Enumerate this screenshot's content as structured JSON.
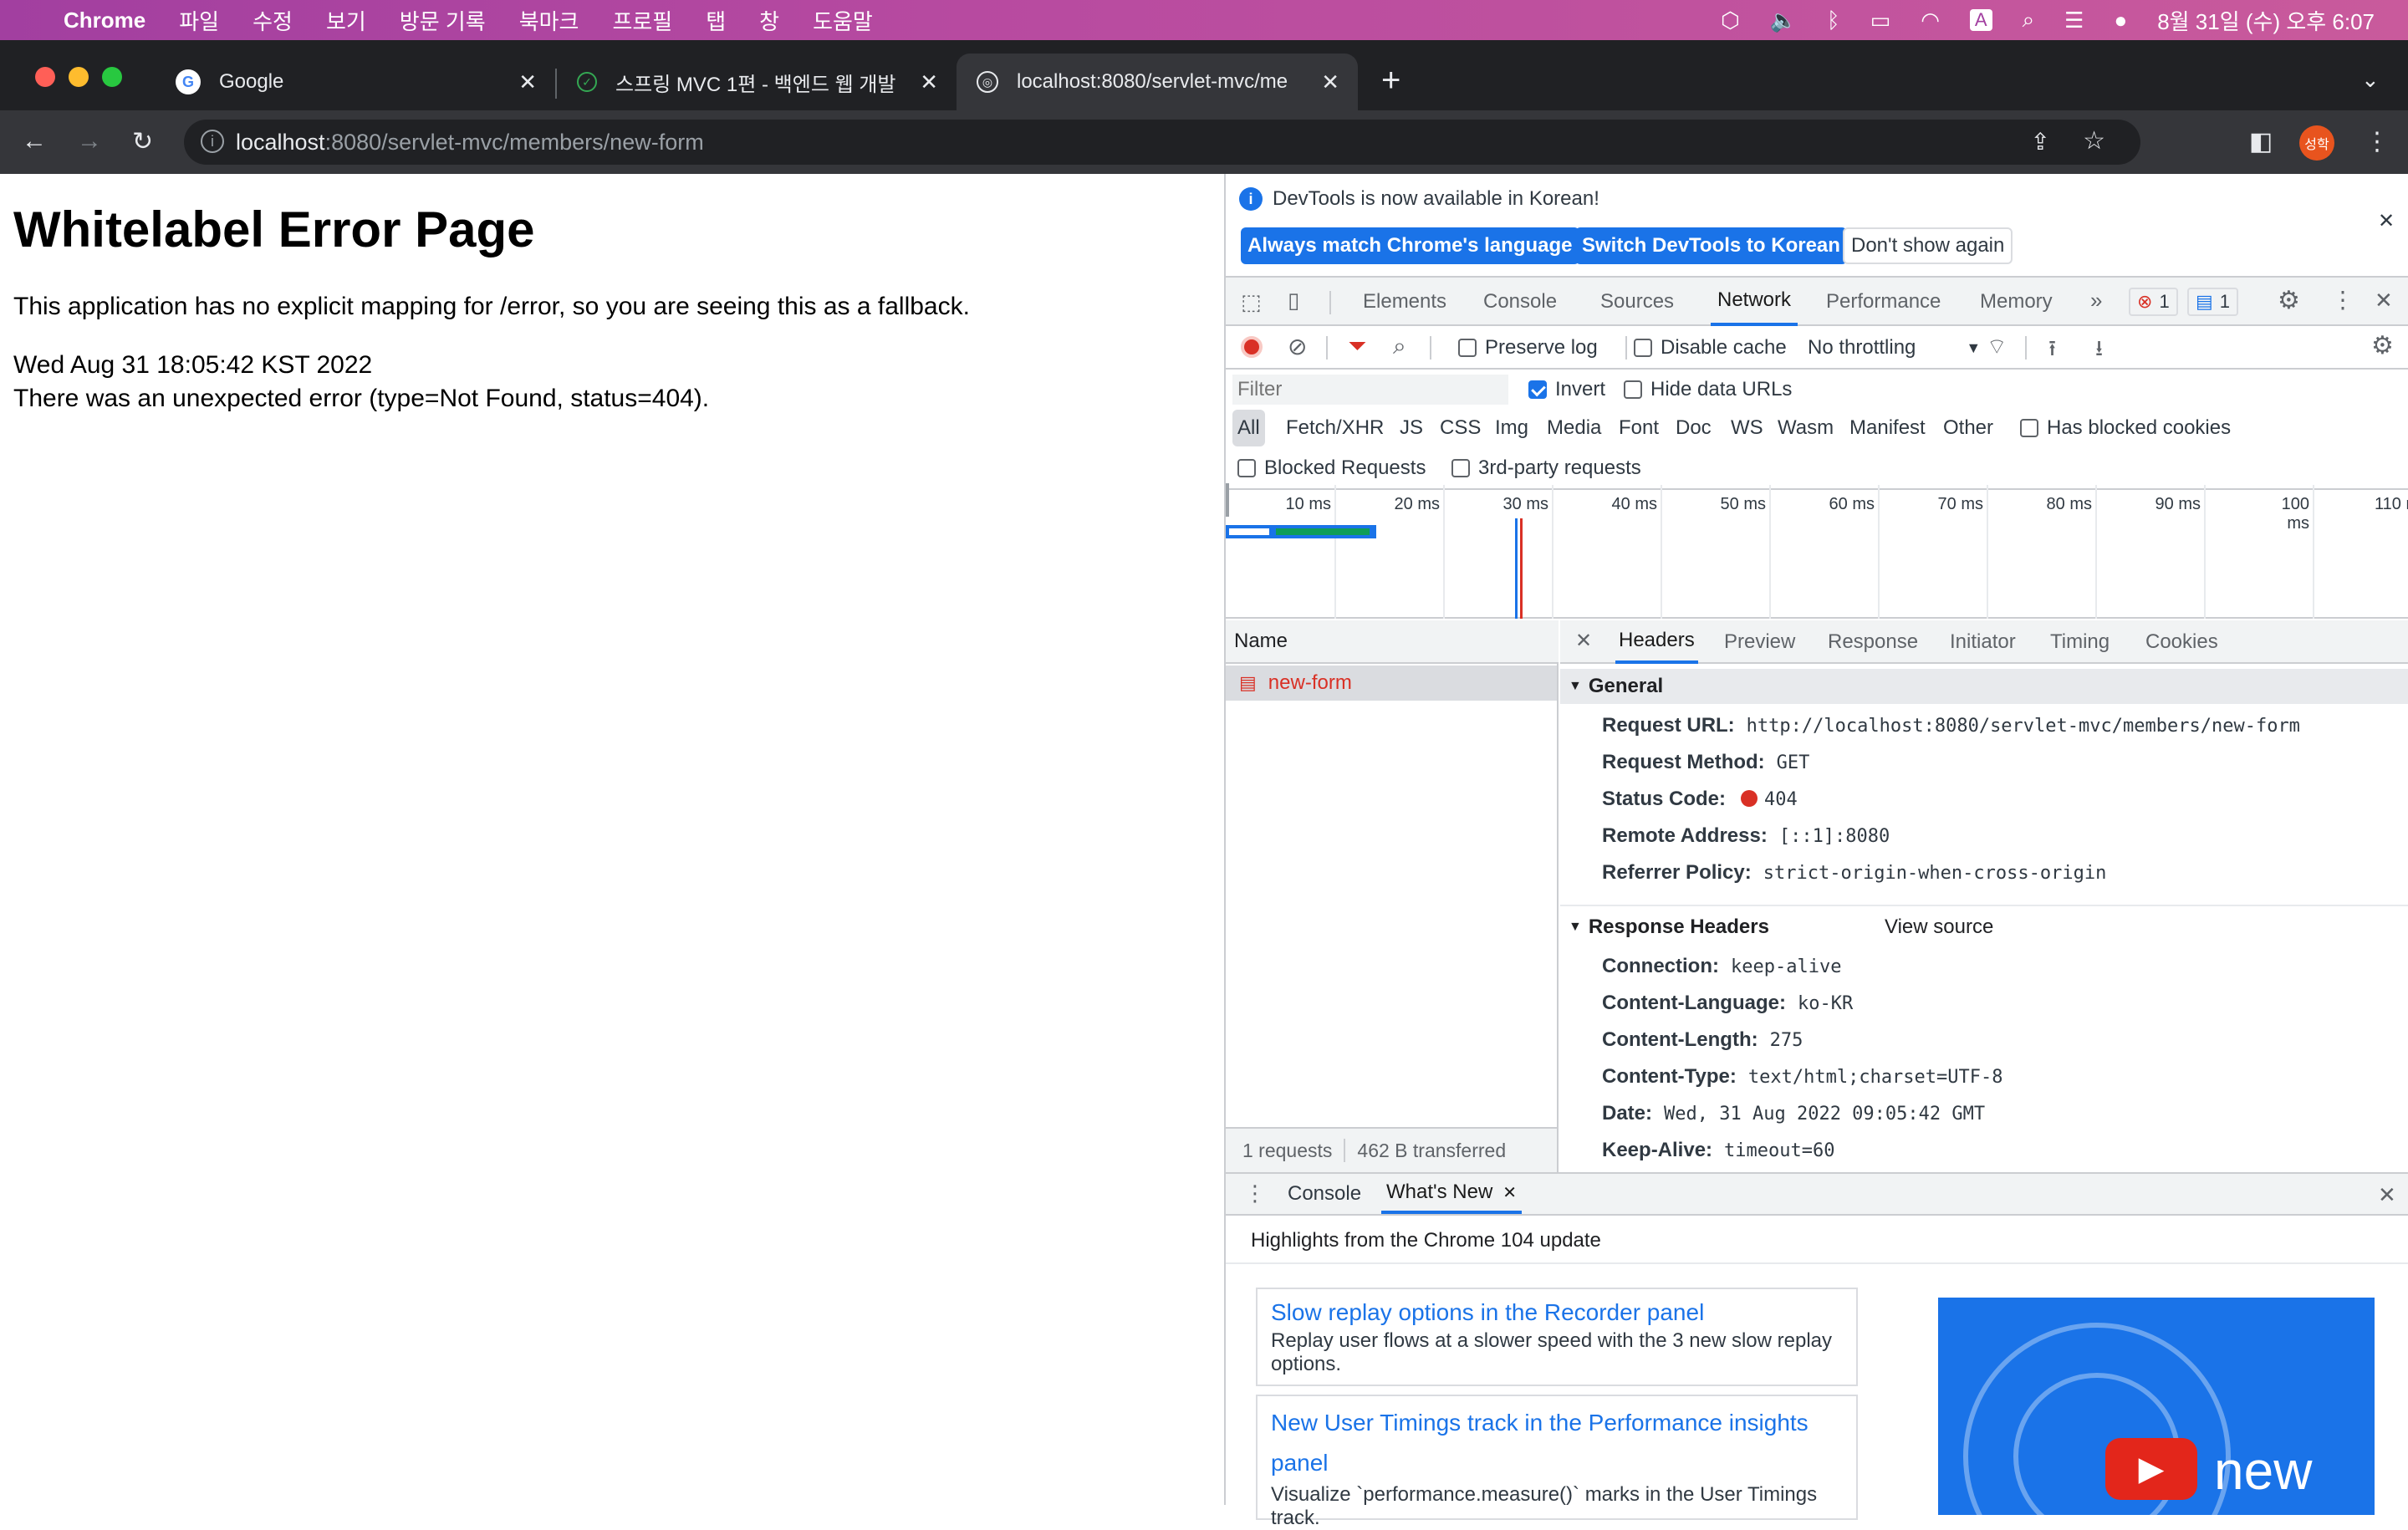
{
  "menubar": {
    "app": "Chrome",
    "items": [
      "파일",
      "수정",
      "보기",
      "방문 기록",
      "북마크",
      "프로필",
      "탭",
      "창",
      "도움말"
    ],
    "clock": "8월 31일 (수) 오후 6:07"
  },
  "tabs": [
    {
      "title": "Google",
      "icon": "google-icon"
    },
    {
      "title": "스프링 MVC 1편 - 백엔드 웹 개발 핵",
      "icon": "inflearn-icon"
    },
    {
      "title": "localhost:8080/servlet-mvc/me",
      "icon": "globe-icon"
    }
  ],
  "omnibox": {
    "host": "localhost",
    "path": ":8080/servlet-mvc/members/new-form"
  },
  "profile": {
    "initials": "성학"
  },
  "page": {
    "title": "Whitelabel Error Page",
    "line1": "This application has no explicit mapping for /error, so you are seeing this as a fallback.",
    "line2": "Wed Aug 31 18:05:42 KST 2022",
    "line3": "There was an unexpected error (type=Not Found, status=404)."
  },
  "devtools": {
    "banner": {
      "text": "DevTools is now available in Korean!",
      "btn_match": "Always match Chrome's language",
      "btn_switch": "Switch DevTools to Korean",
      "btn_dont": "Don't show again"
    },
    "tabs": [
      "Elements",
      "Console",
      "Sources",
      "Network",
      "Performance",
      "Memory"
    ],
    "error_count": "1",
    "message_count": "1",
    "toolbar": {
      "preserve_log": "Preserve log",
      "disable_cache": "Disable cache",
      "throttling": "No throttling"
    },
    "filter": {
      "placeholder": "Filter",
      "invert": "Invert",
      "hide_data": "Hide data URLs"
    },
    "types": [
      "All",
      "Fetch/XHR",
      "JS",
      "CSS",
      "Img",
      "Media",
      "Font",
      "Doc",
      "WS",
      "Wasm",
      "Manifest",
      "Other"
    ],
    "has_blocked": "Has blocked cookies",
    "blocked_requests": "Blocked Requests",
    "third_party": "3rd-party requests",
    "timeline_ticks": [
      "10 ms",
      "20 ms",
      "30 ms",
      "40 ms",
      "50 ms",
      "60 ms",
      "70 ms",
      "80 ms",
      "90 ms",
      "100 ms",
      "110 r"
    ],
    "name_header": "Name",
    "request_name": "new-form",
    "summary": {
      "requests": "1 requests",
      "transferred": "462 B transferred"
    },
    "detail_tabs": [
      "Headers",
      "Preview",
      "Response",
      "Initiator",
      "Timing",
      "Cookies"
    ],
    "general_title": "General",
    "general": [
      {
        "k": "Request URL:",
        "v": "http://localhost:8080/servlet-mvc/members/new-form"
      },
      {
        "k": "Request Method:",
        "v": "GET"
      },
      {
        "k": "Status Code:",
        "v": "404"
      },
      {
        "k": "Remote Address:",
        "v": "[::1]:8080"
      },
      {
        "k": "Referrer Policy:",
        "v": "strict-origin-when-cross-origin"
      }
    ],
    "response_title": "Response Headers",
    "view_source": "View source",
    "response": [
      {
        "k": "Connection:",
        "v": "keep-alive"
      },
      {
        "k": "Content-Language:",
        "v": "ko-KR"
      },
      {
        "k": "Content-Length:",
        "v": "275"
      },
      {
        "k": "Content-Type:",
        "v": "text/html;charset=UTF-8"
      },
      {
        "k": "Date:",
        "v": "Wed, 31 Aug 2022 09:05:42 GMT"
      },
      {
        "k": "Keep-Alive:",
        "v": "timeout=60"
      }
    ],
    "drawer": {
      "console": "Console",
      "whats_new": "What's New",
      "highlights": "Highlights from the Chrome 104 update",
      "card1_title": "Slow replay options in the Recorder panel",
      "card1_text": "Replay user flows at a slower speed with the 3 new slow replay options.",
      "card2_title": "New User Timings track in the Performance insights panel",
      "card2_text": "Visualize `performance.measure()` marks in the User Timings track.",
      "video_word": "new"
    }
  },
  "colors": {
    "accent": "#1a73e8",
    "error": "#d93025",
    "menubar": "#b74aa0"
  }
}
